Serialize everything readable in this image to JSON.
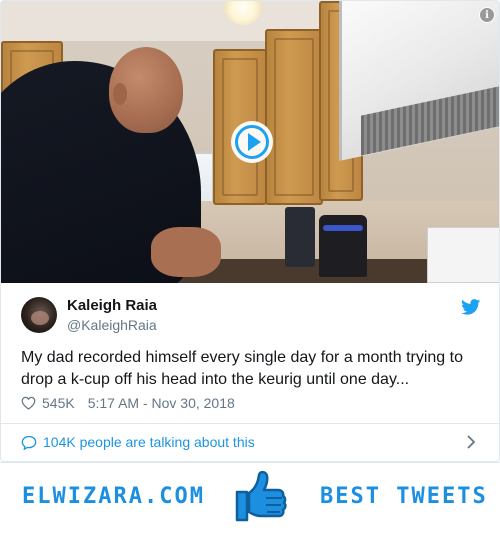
{
  "video": {
    "play_icon": "play-circle-icon",
    "info_icon": "info-icon",
    "info_glyph": "i"
  },
  "tweet": {
    "author": {
      "display_name": "Kaleigh Raia",
      "handle": "@KaleighRaia",
      "avatar_icon": "avatar"
    },
    "text": "My dad recorded himself every single day for a month trying to drop a k-cup off his head into the keurig until one day...",
    "likes": "545K",
    "timestamp": "5:17 AM - Nov 30, 2018",
    "conversation": "104K people are talking about this"
  },
  "banner": {
    "site": "ELWIZARA.COM",
    "tagline": "BEST TWEETS",
    "icon": "thumbs-up-icon"
  },
  "colors": {
    "twitter_blue": "#1da1f2",
    "link_blue": "#1b95e0",
    "banner_blue": "#1d8fe0",
    "secondary_text": "#657786",
    "primary_text": "#14171a",
    "border": "#e1e8ed"
  }
}
